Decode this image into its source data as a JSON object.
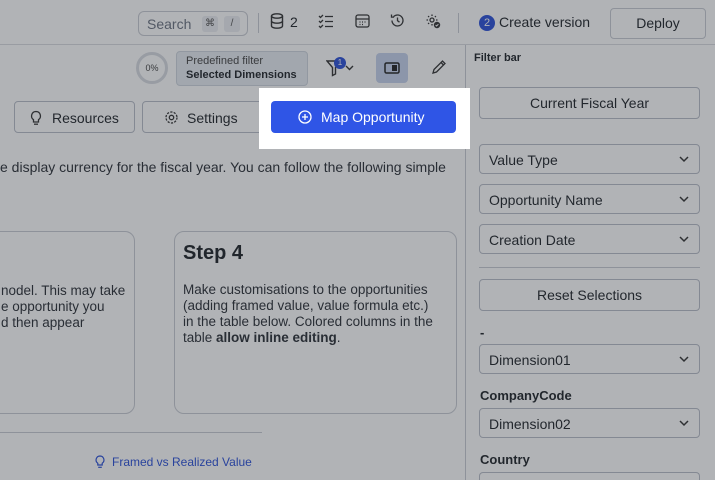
{
  "topbar": {
    "search_placeholder": "Search",
    "kbd_1": "⌘",
    "kbd_2": "/",
    "db_count": "2",
    "version_number": "2",
    "create_version_label": "Create version",
    "deploy_label": "Deploy"
  },
  "toolbar": {
    "progress": "0%",
    "predefined_filter_label": "Predefined filter",
    "predefined_filter_value": "Selected Dimensions",
    "filter_badge": "1"
  },
  "actions": {
    "resources_label": "Resources",
    "settings_label": "Settings",
    "map_opportunity_label": "Map Opportunity"
  },
  "content": {
    "description": "e display currency for the fiscal year. You can follow the following simple",
    "left_card_lines": [
      "nodel. This may take",
      "e opportunity you",
      "d then appear"
    ],
    "step4_title": "Step 4",
    "step4_lines": [
      "Make customisations to the opportunities",
      "(adding framed value, value formula etc.)",
      "in the table below. Colored columns in the"
    ],
    "step4_last_prefix": "table ",
    "step4_last_bold": "allow inline editing",
    "step4_last_suffix": ".",
    "framed_link": "Framed vs Realized Value"
  },
  "filter_panel": {
    "title": "Filter bar",
    "current_fiscal_year": "Current Fiscal Year",
    "selects": [
      "Value Type",
      "Opportunity Name",
      "Creation Date"
    ],
    "reset_label": "Reset Selections",
    "dash_label": "-",
    "dimension01": "Dimension01",
    "company_code_label": "CompanyCode",
    "dimension02": "Dimension02",
    "country_label": "Country"
  },
  "colors": {
    "accent": "#2f55e6",
    "overlay": "rgba(40,44,52,0.36)"
  }
}
